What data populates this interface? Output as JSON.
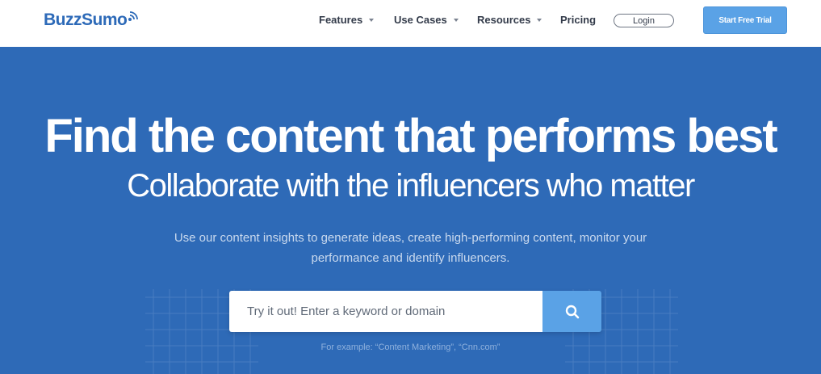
{
  "brand": {
    "name": "BuzzSumo",
    "color": "#2d6ab8"
  },
  "nav": {
    "items": [
      {
        "label": "Features",
        "dropdown": true
      },
      {
        "label": "Use Cases",
        "dropdown": true
      },
      {
        "label": "Resources",
        "dropdown": true
      },
      {
        "label": "Pricing",
        "dropdown": false
      }
    ],
    "login_label": "Login",
    "trial_label": "Start Free Trial"
  },
  "hero": {
    "headline": "Find the content that performs best",
    "subheadline": "Collaborate with the influencers who matter",
    "description": "Use our content insights to generate ideas, create high-performing content, monitor your performance and identify influencers.",
    "search": {
      "placeholder": "Try it out! Enter a keyword or domain",
      "value": "",
      "button_icon": "search-icon"
    },
    "example": "For example: “Content Marketing”, “Cnn.com”"
  },
  "colors": {
    "hero_bg": "#2e6ab7",
    "accent": "#5aa2e6",
    "nav_text": "#333b4a"
  }
}
